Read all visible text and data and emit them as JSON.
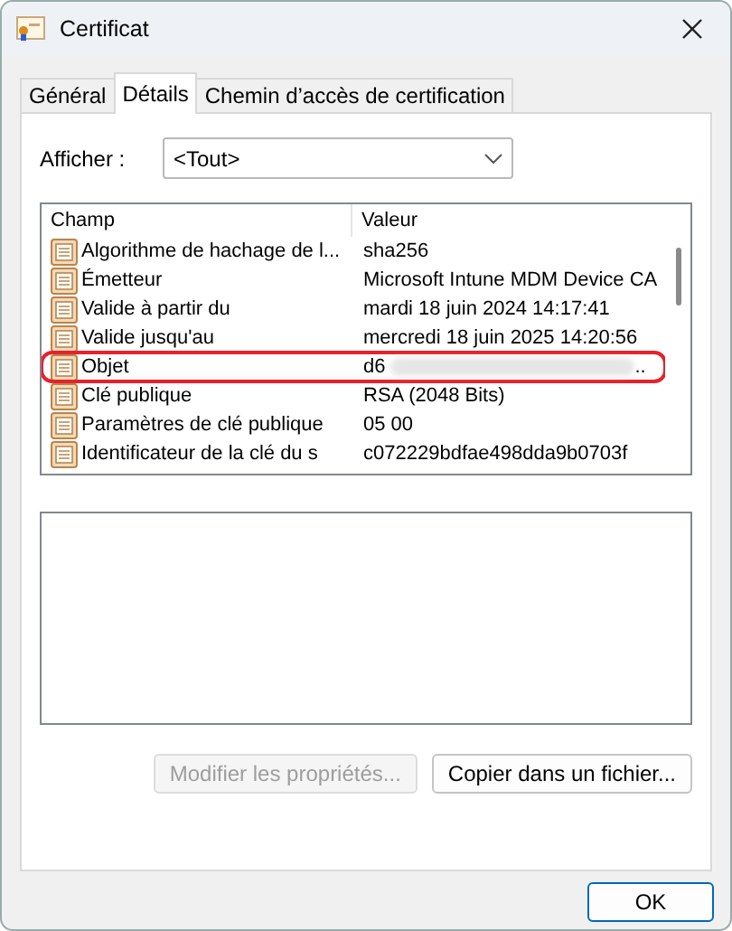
{
  "window": {
    "title": "Certificat"
  },
  "tabs": [
    {
      "label": "Général",
      "selected": false
    },
    {
      "label": "Détails",
      "selected": true
    },
    {
      "label": "Chemin d’accès de certification",
      "selected": false
    }
  ],
  "show": {
    "label": "Afficher :",
    "value": "<Tout>"
  },
  "table": {
    "columns": [
      "Champ",
      "Valeur"
    ],
    "rows": [
      {
        "field": "Algorithme de hachage de l...",
        "value": "sha256",
        "highlighted": false
      },
      {
        "field": "Émetteur",
        "value": "Microsoft Intune MDM Device CA",
        "highlighted": false
      },
      {
        "field": "Valide à partir du",
        "value": "mardi 18 juin 2024 14:17:41",
        "highlighted": false
      },
      {
        "field": "Valide jusqu'au",
        "value": "mercredi 18 juin 2025 14:20:56",
        "highlighted": false
      },
      {
        "field": "Objet",
        "value": "d6",
        "redacted": true,
        "value_end": "..",
        "highlighted": true
      },
      {
        "field": "Clé publique",
        "value": "RSA (2048 Bits)",
        "highlighted": false
      },
      {
        "field": "Paramètres de clé publique",
        "value": "05 00",
        "highlighted": false
      },
      {
        "field": "Identificateur de la clé du s",
        "value": "c072229bdfae498dda9b0703f",
        "highlighted": false
      }
    ]
  },
  "buttons": [
    {
      "label": "Modifier les propriétés...",
      "disabled": true
    },
    {
      "label": "Copier dans un fichier...",
      "disabled": false
    }
  ],
  "ok": {
    "label": "OK"
  }
}
